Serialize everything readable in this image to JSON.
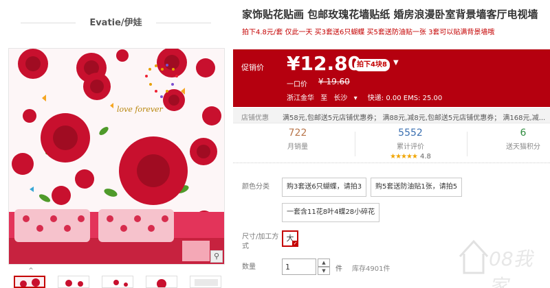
{
  "shop": {
    "name": "Evatie/伊娃"
  },
  "product": {
    "title": "家饰贴花贴画 包邮玫瑰花墙贴纸 婚房浪漫卧室背景墙客厅电视墙",
    "subtitle": "拍下4.8元/套 仅此一天 买3套送6只蝴蝶 买5套送防油贴一张 3套可以贴满背景墙哦"
  },
  "image": {
    "caption": "love forever"
  },
  "price": {
    "label": "促销价",
    "value": "¥12.80",
    "promo": "拍下4块8",
    "old_label": "一口价",
    "old_value": "¥ 19.60"
  },
  "shipping": {
    "from": "浙江金华",
    "to_label": "至",
    "to": "长沙",
    "fee": "快递: 0.00 EMS: 25.00"
  },
  "coupon": {
    "label": "店铺优惠",
    "text": "满58元,包邮送5元店铺优惠券； 满88元,减8元,包邮送5元店铺优惠券； 满168元,减..."
  },
  "stats": {
    "sales": {
      "value": "722",
      "label": "月销量"
    },
    "reviews": {
      "value": "5552",
      "label": "累计评价",
      "rating": "4.8"
    },
    "points": {
      "value": "6",
      "label": "送天猫积分"
    }
  },
  "options": {
    "color_label": "颜色分类",
    "colors": [
      "购3套送6只蝴蝶，请拍3",
      "购5套送防油贴1张，请拍5",
      "一套含11花8叶4蝶28小碎花"
    ],
    "size_label": "尺寸/加工方式",
    "size_value": "大"
  },
  "quantity": {
    "label": "数量",
    "value": "1",
    "unit": "件",
    "stock": "库存4901件"
  },
  "watermark": {
    "text": "08我家"
  },
  "icons": [
    "zoom-icon",
    "chevron-up-icon",
    "chevron-down-icon",
    "star-icon",
    "check-icon",
    "watermark-house-icon"
  ],
  "colors": {
    "accent": "#c40000",
    "price_bg": "#b5000f",
    "stars": "#f0a500"
  }
}
